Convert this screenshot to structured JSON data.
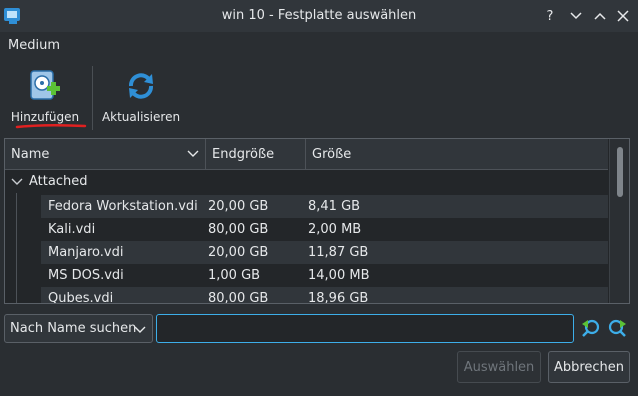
{
  "window": {
    "title": "win 10 - Festplatte auswählen",
    "help_glyph": "?",
    "icons": [
      "app-icon",
      "help-icon",
      "minimize-icon",
      "maximize-icon"
    ]
  },
  "menu": {
    "medium_label": "Medium"
  },
  "toolbar": {
    "add_label": "Hinzufügen",
    "refresh_label": "Aktualisieren",
    "add_icon": "harddisk-add-icon",
    "refresh_icon": "refresh-icon"
  },
  "table": {
    "columns": [
      "Name",
      "Endgröße",
      "Größe"
    ],
    "group_label": "Attached",
    "rows": [
      {
        "name": "Fedora Workstation.vdi",
        "endsize": "20,00 GB",
        "size": "8,41 GB"
      },
      {
        "name": "Kali.vdi",
        "endsize": "80,00 GB",
        "size": "2,00 MB"
      },
      {
        "name": "Manjaro.vdi",
        "endsize": "20,00 GB",
        "size": "11,87 GB"
      },
      {
        "name": "MS DOS.vdi",
        "endsize": "1,00 GB",
        "size": "14,00 MB"
      },
      {
        "name": "Qubes.vdi",
        "endsize": "80,00 GB",
        "size": "18,96 GB"
      }
    ]
  },
  "search": {
    "mode_label": "Nach Name suchen",
    "value": "",
    "placeholder": ""
  },
  "buttons": {
    "choose_label": "Auswählen",
    "cancel_label": "Abbrechen"
  },
  "colors": {
    "background": "#2a2e32",
    "accent": "#3daee9",
    "annotation": "#e02020"
  }
}
